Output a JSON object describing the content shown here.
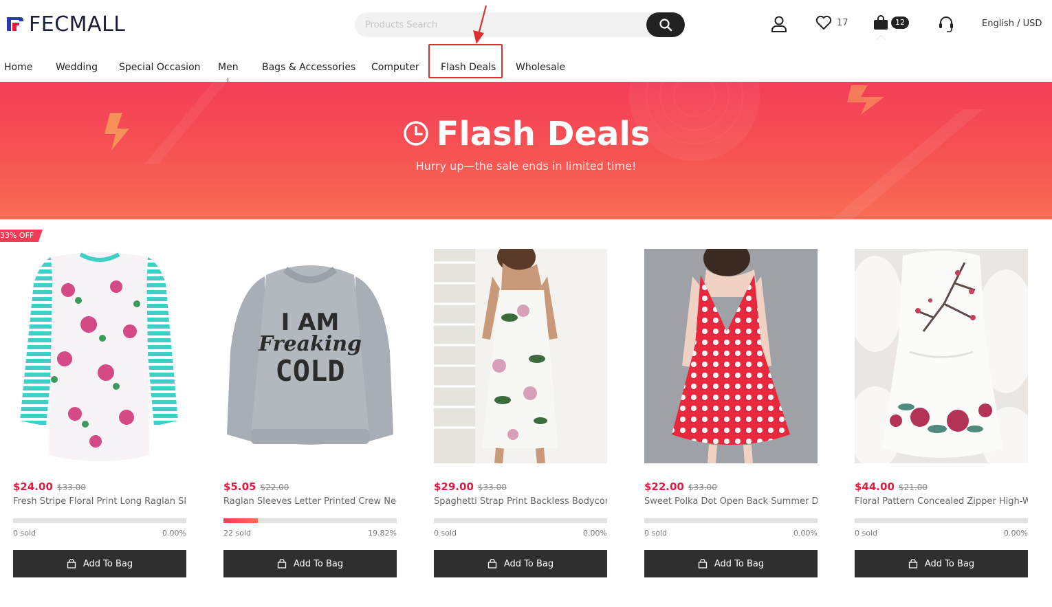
{
  "header": {
    "logo_text": "FECMALL",
    "search_placeholder": "Products Search",
    "wishlist_count": "17",
    "bag_count": "12",
    "language_currency": "English / USD"
  },
  "nav": [
    {
      "label": "Home"
    },
    {
      "label": "Wedding"
    },
    {
      "label": "Special Occasion"
    },
    {
      "label": "Men"
    },
    {
      "label": "Bags & Accessories"
    },
    {
      "label": "Computer"
    },
    {
      "label": "Flash Deals"
    },
    {
      "label": "Wholesale"
    }
  ],
  "annotation": {
    "color": "#e02d2d"
  },
  "banner": {
    "title": "Flash Deals",
    "subtitle": "Hurry up—the sale ends in limited time!",
    "gradient_top": "#f43d58",
    "gradient_bottom": "#f86d54"
  },
  "discount_badge": "33% OFF",
  "products": [
    {
      "price": "$24.00",
      "old_price": "$33.00",
      "name": "Fresh Stripe Floral Print Long Raglan Sle...",
      "sold": "0 sold",
      "percent": "0.00%",
      "progress": 0.0,
      "button": "Add To Bag",
      "image": "floral-raglan-top"
    },
    {
      "price": "$5.05",
      "old_price": "$22.00",
      "name": "Raglan Sleeves Letter Printed Crew Nec...",
      "sold": "22 sold",
      "percent": "19.82%",
      "progress": 0.1982,
      "button": "Add To Bag",
      "image": "grey-sweatshirt"
    },
    {
      "price": "$29.00",
      "old_price": "$33.00",
      "name": "Spaghetti Strap Print Backless Bodycon ...",
      "sold": "0 sold",
      "percent": "0.00%",
      "progress": 0.0,
      "button": "Add To Bag",
      "image": "floral-bodycon-dress"
    },
    {
      "price": "$22.00",
      "old_price": "$33.00",
      "name": "Sweet Polka Dot Open Back Summer Dr...",
      "sold": "0 sold",
      "percent": "0.00%",
      "progress": 0.0,
      "button": "Add To Bag",
      "image": "red-polka-dress"
    },
    {
      "price": "$44.00",
      "old_price": "$21.00",
      "name": "Floral Pattern Concealed Zipper High-W...",
      "sold": "0 sold",
      "percent": "0.00%",
      "progress": 0.0,
      "button": "Add To Bag",
      "image": "white-floral-dress"
    }
  ],
  "sweatshirt_print": [
    "I AM",
    "Freaking",
    "COLD"
  ]
}
